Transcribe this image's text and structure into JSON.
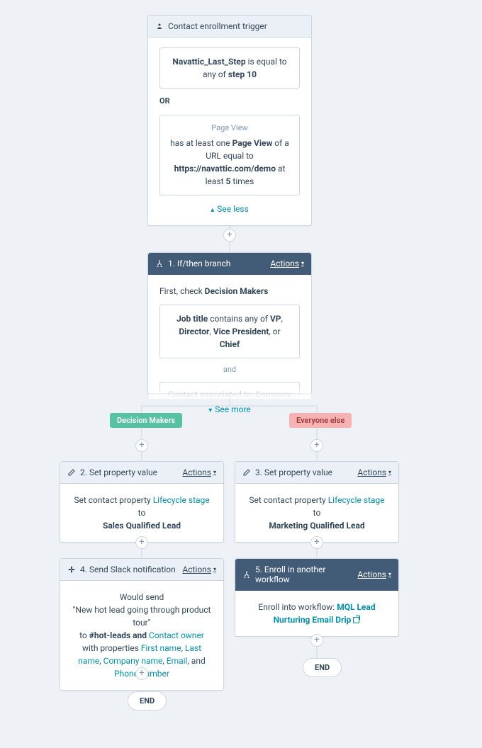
{
  "actions_label": "Actions",
  "trigger": {
    "title": "Contact enrollment trigger",
    "crit1_prefix": "Navattic_Last_Step",
    "crit1_mid": " is equal to any of ",
    "crit1_value": "step 10",
    "or_label": "OR",
    "crit2_sub": "Page View",
    "crit2_line1_a": "has at least one ",
    "crit2_line1_b": "Page View",
    "crit2_line1_c": " of a URL equal to",
    "crit2_url": "https://navattic.com/demo",
    "crit2_atleast": "  at least ",
    "crit2_count": "5",
    "crit2_times": " times",
    "see_less": "See less"
  },
  "branch": {
    "title": "1. If/then branch",
    "first_check_a": "First, check ",
    "first_check_b": "Decision Makers",
    "c1_a": "Job title",
    "c1_b": " contains any of ",
    "c1_c": "VP",
    "c1_d": ", ",
    "c1_e": "Director",
    "c1_f": ", ",
    "c1_g": "Vice President",
    "c1_h": ", or ",
    "c1_i": "Chief",
    "and_label": "and",
    "c2": "Contact associated to: Company",
    "see_more": "See more"
  },
  "labels": {
    "decision_makers": "Decision Makers",
    "everyone_else": "Everyone else"
  },
  "set2": {
    "title": "2. Set property value",
    "body_a": "Set contact property ",
    "body_b": "Lifecycle stage",
    "body_c": " to",
    "body_d": "Sales Qualified Lead"
  },
  "set3": {
    "title": "3. Set property value",
    "body_a": "Set contact property ",
    "body_b": "Lifecycle stage",
    "body_c": " to",
    "body_d": "Marketing Qualified Lead"
  },
  "slack": {
    "title": "4. Send Slack notification",
    "l1": "Would send",
    "l2": "\"New hot lead going through product tour\"",
    "l3_a": "to ",
    "l3_b": "#hot-leads and ",
    "l3_c": "Contact owner",
    "l3_d": " with properties ",
    "p1": "First name",
    "sep": ", ",
    "p2": "Last name",
    "p3": "Company name",
    "p4": "Email",
    "and": ", and ",
    "p5": "Phone number"
  },
  "enroll": {
    "title": "5. Enroll in another workflow",
    "body_a": "Enroll into workflow: ",
    "body_b": "MQL Lead Nurturing Email Drip"
  },
  "end": "END"
}
